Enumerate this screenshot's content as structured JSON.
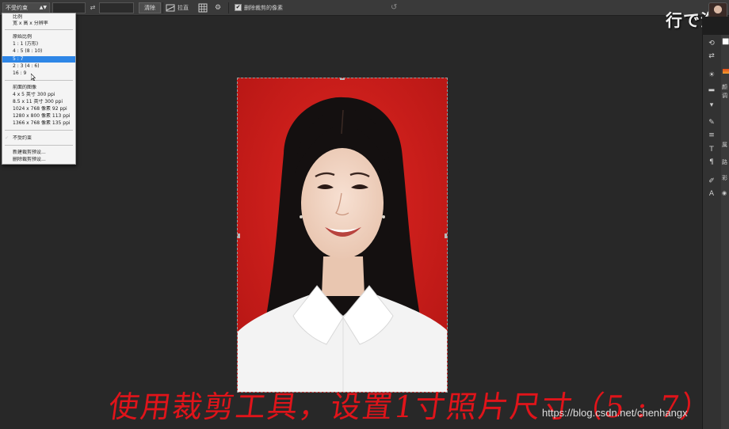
{
  "options_bar": {
    "ratio_select_value": "不受约束",
    "swap_icon": "swap-arrows-icon",
    "clear_label": "清除",
    "straighten_label": "拉直",
    "delete_cropped_checked": "✔",
    "delete_cropped_label": "删除裁剪的像素"
  },
  "watermark_top": "行で海",
  "ratio_menu": {
    "items": [
      {
        "label": "比例"
      },
      {
        "label": "宽 x 高 x 分辨率"
      },
      {
        "label": "原始比例"
      },
      {
        "label": "1 : 1 (方形)"
      },
      {
        "label": "4 : 5 (8 : 10)"
      },
      {
        "label": "5 : 7"
      },
      {
        "label": "2 : 3 (4 : 6)"
      },
      {
        "label": "16 : 9"
      },
      {
        "label": "前面的图像"
      },
      {
        "label": "4 x 5 英寸 300 ppi"
      },
      {
        "label": "8.5 x 11 英寸 300 ppi"
      },
      {
        "label": "1024 x 768 像素 92 ppi"
      },
      {
        "label": "1280 x 800 像素 113 ppi"
      },
      {
        "label": "1366 x 768 像素 135 ppi"
      },
      {
        "label": "不受约束"
      },
      {
        "label": "新建裁剪预设..."
      },
      {
        "label": "删除裁剪预设..."
      }
    ],
    "selected_label": "5 : 7",
    "checked_label": "不受约束"
  },
  "right_panel": {
    "tab_texts": [
      "颜",
      "调",
      "属",
      "路",
      "彩"
    ]
  },
  "caption": "使用裁剪工具，设置1寸照片尺寸（5 : 7）",
  "csdn_watermark": "https://blog.csdn.net/chenhangx",
  "colors": {
    "app_background": "#282828",
    "options_bar": "#3a3a3a",
    "photo_background_red": "#cc1c1a",
    "menu_selection": "#2e86e6",
    "caption_red": "#e0141a"
  }
}
